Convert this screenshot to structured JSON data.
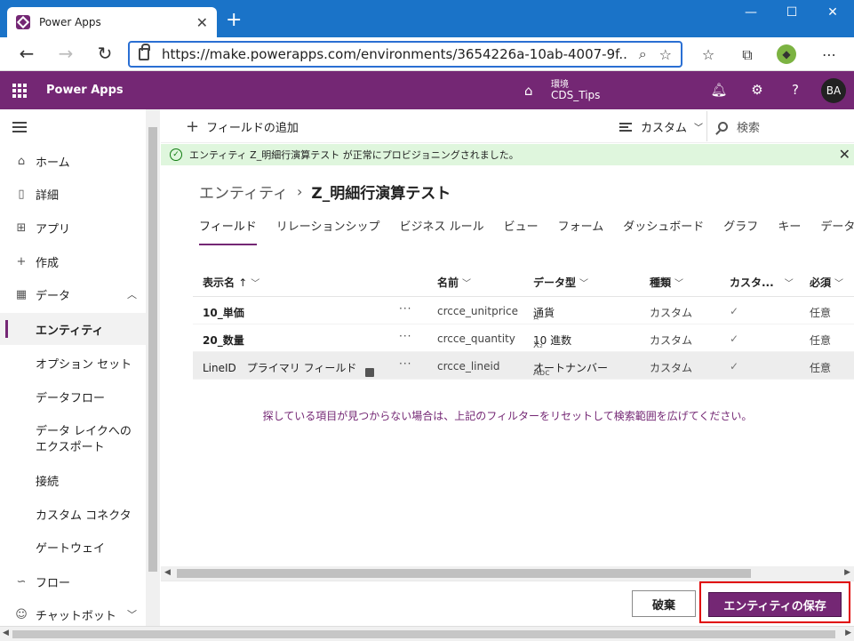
{
  "browser": {
    "tab_title": "Power Apps",
    "url": "https://make.powerapps.com/environments/3654226a-10ab-4007-9f..."
  },
  "header": {
    "app_name": "Power Apps",
    "env_label": "環境",
    "env_name": "CDS_Tips",
    "avatar": "BA"
  },
  "nav": {
    "items": [
      {
        "label": "ホーム",
        "icon": "home-icon"
      },
      {
        "label": "詳細",
        "icon": "book-icon"
      },
      {
        "label": "アプリ",
        "icon": "apps-icon"
      },
      {
        "label": "作成",
        "icon": "plus-icon"
      },
      {
        "label": "データ",
        "icon": "table-icon"
      }
    ],
    "data_children": [
      "エンティティ",
      "オプション セット",
      "データフロー",
      "データ レイクへのエクスポート",
      "接続",
      "カスタム コネクタ",
      "ゲートウェイ"
    ],
    "flow": "フロー",
    "chatbot": "チャットボット"
  },
  "commands": {
    "add_field": "フィールドの追加",
    "view": "カスタム",
    "search_placeholder": "検索"
  },
  "message": "エンティティ Z_明細行演算テスト が正常にプロビジョニングされました。",
  "breadcrumb": {
    "parent": "エンティティ",
    "current": "Z_明細行演算テスト"
  },
  "tabs": [
    "フィールド",
    "リレーションシップ",
    "ビジネス ルール",
    "ビュー",
    "フォーム",
    "ダッシュボード",
    "グラフ",
    "キー",
    "データ"
  ],
  "grid": {
    "headers": {
      "display": "表示名",
      "sort_arrow": "↑",
      "name": "名前",
      "type": "データ型",
      "kind": "種類",
      "custom": "カスタ...",
      "required": "必須"
    },
    "rows": [
      {
        "display": "10_単価",
        "name": "crcce_unitprice",
        "type_icon": "¤",
        "type": "通貨",
        "kind": "カスタム",
        "custom": "✓",
        "required": "任意"
      },
      {
        "display": "20_数量",
        "name": "crcce_quantity",
        "type_icon": "X₂",
        "type": "10 進数",
        "kind": "カスタム",
        "custom": "✓",
        "required": "任意"
      },
      {
        "display": "LineID",
        "primary": "プライマリ フィールド",
        "name": "crcce_lineid",
        "type_icon": "Abc",
        "type": "オートナンバー",
        "kind": "カスタム",
        "custom": "✓",
        "required": "任意"
      }
    ]
  },
  "hint": "探している項目が見つからない場合は、上記のフィルターをリセットして検索範囲を広げてください。",
  "footer": {
    "discard": "破棄",
    "save": "エンティティの保存"
  }
}
